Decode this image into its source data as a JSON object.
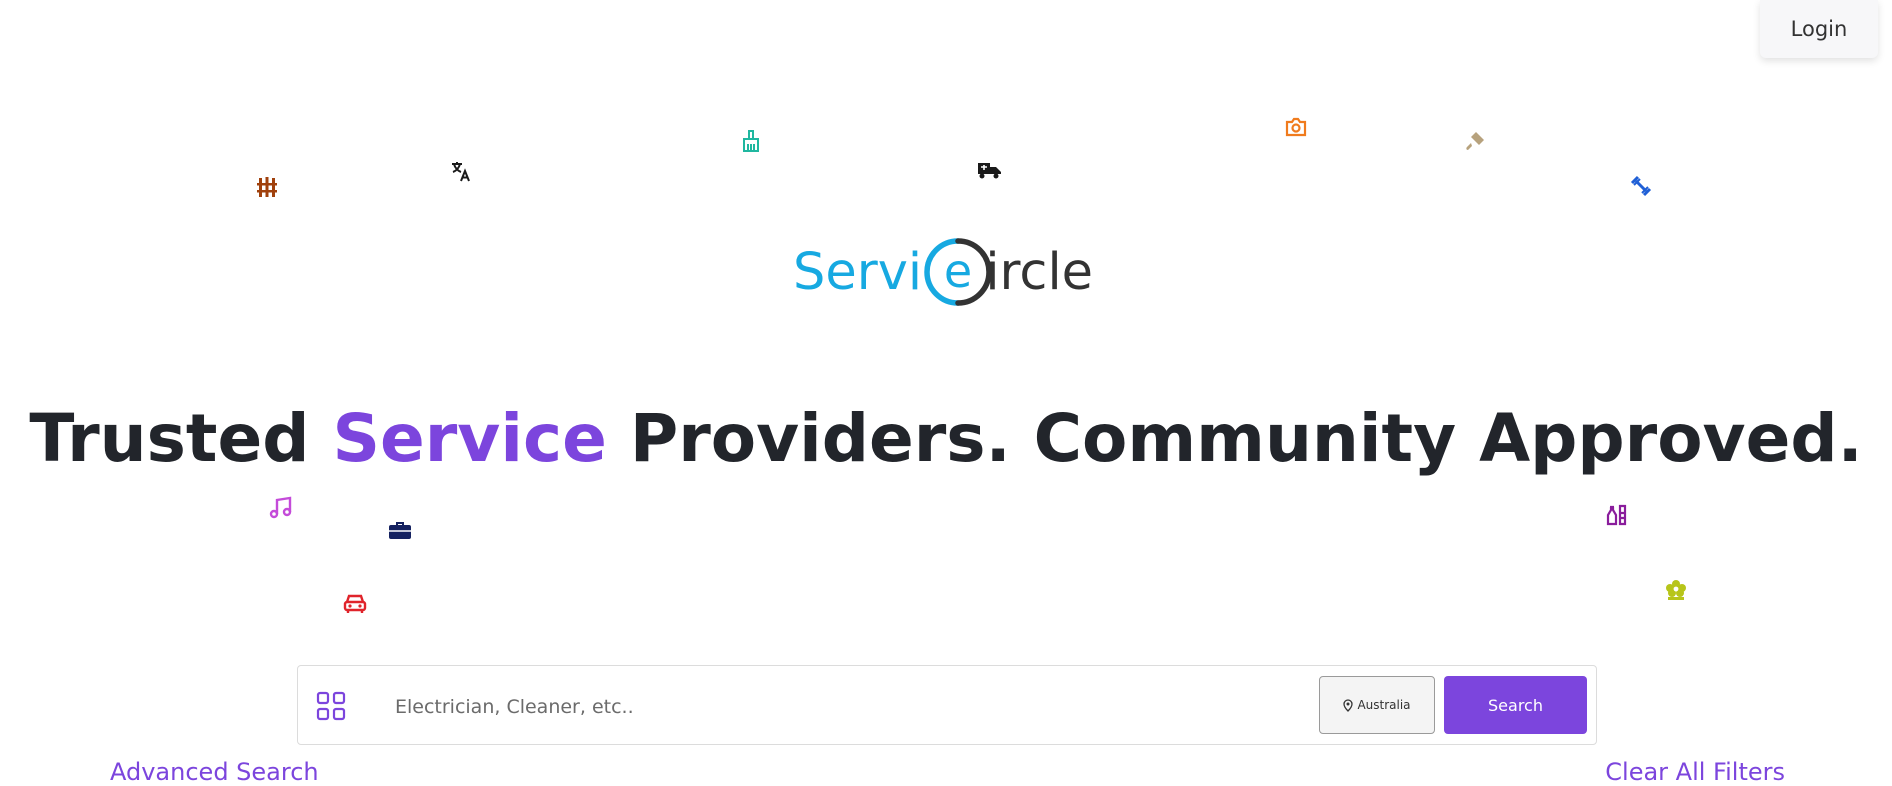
{
  "header": {
    "login_label": "Login"
  },
  "brand": {
    "logo_text_left": "Servi",
    "logo_mark_letter": "e",
    "logo_text_right": "ircle",
    "color_primary": "#17a9e1",
    "color_dark": "#333333"
  },
  "hero": {
    "headline_pre": "Trusted ",
    "headline_accent": "Service",
    "headline_post": " Providers. Community Approved.",
    "accent_color": "#7c45dd"
  },
  "floating_icons": [
    {
      "name": "fence-icon",
      "color": "#a0410d"
    },
    {
      "name": "translate-icon",
      "color": "#1a1a1a"
    },
    {
      "name": "broom-icon",
      "color": "#20b7a0"
    },
    {
      "name": "tow-truck-icon",
      "color": "#1a1a1a"
    },
    {
      "name": "camera-icon",
      "color": "#f07b1d"
    },
    {
      "name": "paint-brush-icon",
      "color": "#b7a27d"
    },
    {
      "name": "dumbbell-icon",
      "color": "#1f5fd6"
    },
    {
      "name": "music-icon",
      "color": "#c44bd9"
    },
    {
      "name": "briefcase-icon",
      "color": "#152260"
    },
    {
      "name": "car-icon",
      "color": "#e0242b"
    },
    {
      "name": "bottles-icon",
      "color": "#8a1d9c"
    },
    {
      "name": "lotus-icon",
      "color": "#b7c51a"
    }
  ],
  "search": {
    "placeholder": "Electrician, Cleaner, etc..",
    "location_label": "Australia",
    "search_label": "Search",
    "categories_icon": "grid-icon",
    "location_icon": "map-pin-icon"
  },
  "links": {
    "advanced_search": "Advanced Search",
    "clear_filters": "Clear All Filters"
  }
}
